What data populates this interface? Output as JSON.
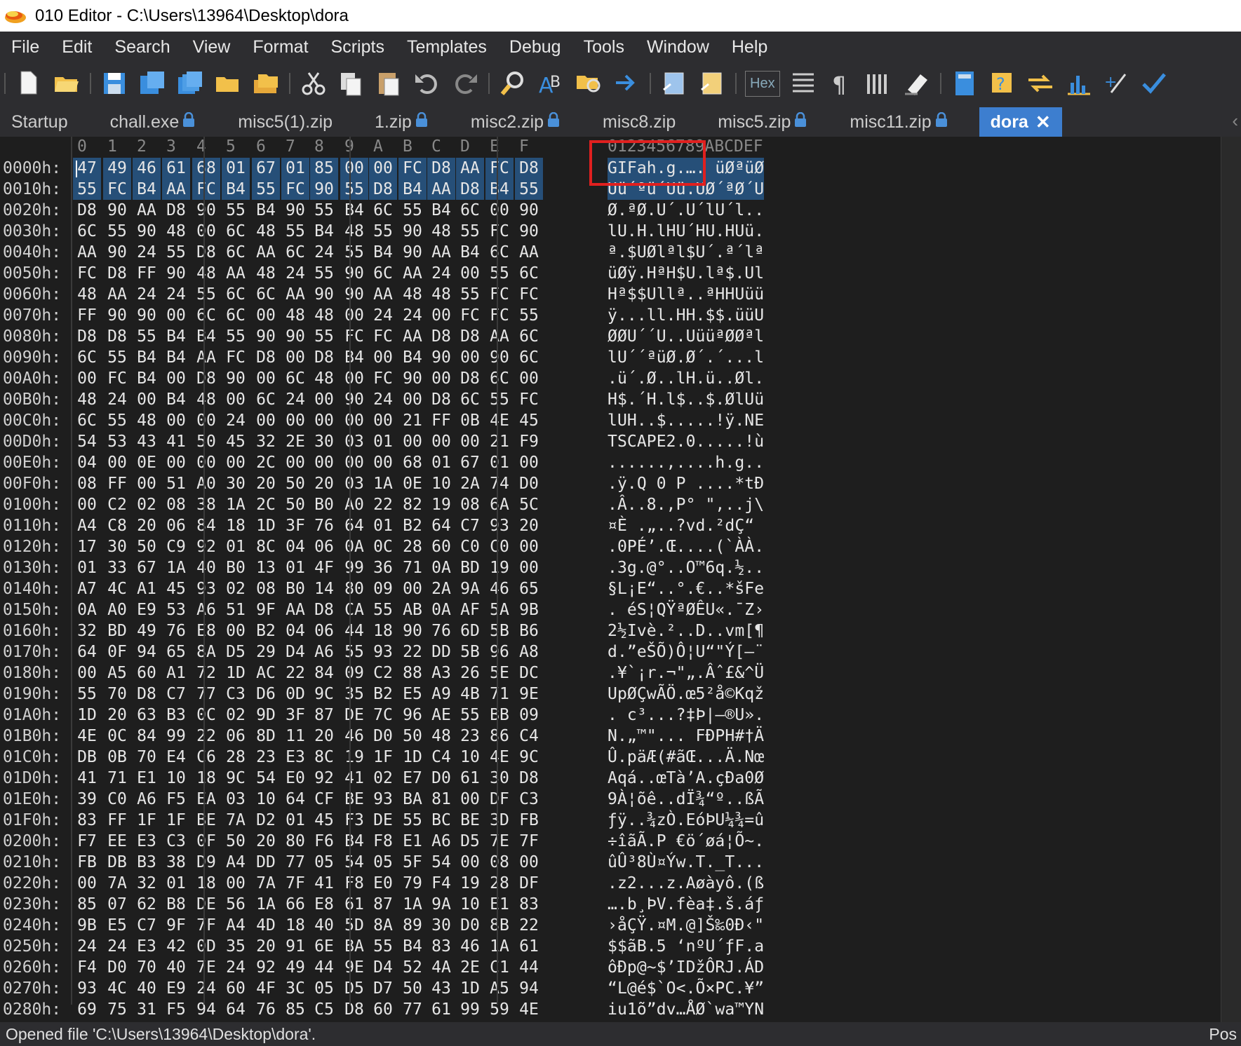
{
  "window": {
    "title": "010 Editor - C:\\Users\\13964\\Desktop\\dora"
  },
  "menu": [
    "File",
    "Edit",
    "Search",
    "View",
    "Format",
    "Scripts",
    "Templates",
    "Debug",
    "Tools",
    "Window",
    "Help"
  ],
  "toolbar": {
    "hex_label": "Hex",
    "icons": [
      "new-file-icon",
      "open-folder-icon",
      "save-icon",
      "save-as-icon",
      "save-all-icon",
      "folder-icon",
      "open-multiple-icon",
      "cut-icon",
      "copy-icon",
      "paste-icon",
      "undo-icon",
      "redo-icon",
      "find-icon",
      "replace-icon",
      "find-in-files-icon",
      "goto-icon",
      "run-script-icon",
      "run-template-icon",
      "hex-toggle-icon",
      "columns-icon",
      "paragraph-icon",
      "layout-icon",
      "highlight-icon",
      "calculator-icon",
      "inspector-icon",
      "compare-icon",
      "histogram-icon",
      "checksum-icon",
      "verify-icon"
    ]
  },
  "tabs": [
    {
      "label": "Startup",
      "lock": false
    },
    {
      "label": "chall.exe",
      "lock": true
    },
    {
      "label": "misc5(1).zip",
      "lock": false
    },
    {
      "label": "1.zip",
      "lock": true
    },
    {
      "label": "misc2.zip",
      "lock": true
    },
    {
      "label": "misc8.zip",
      "lock": false
    },
    {
      "label": "misc5.zip",
      "lock": true
    },
    {
      "label": "misc11.zip",
      "lock": true
    },
    {
      "label": "dora",
      "lock": false,
      "active": true
    }
  ],
  "hex_header": {
    "columns": [
      "0",
      "1",
      "2",
      "3",
      "4",
      "5",
      "6",
      "7",
      "8",
      "9",
      "A",
      "B",
      "C",
      "D",
      "E",
      "F"
    ],
    "ascii_header": "0123456789ABCDEF"
  },
  "rows": [
    {
      "addr": "0000h:",
      "bytes": [
        "47",
        "49",
        "46",
        "61",
        "68",
        "01",
        "67",
        "01",
        "85",
        "00",
        "00",
        "FC",
        "D8",
        "AA",
        "FC",
        "D8"
      ],
      "ascii": "GIFah.g.…. üØªüØ"
    },
    {
      "addr": "0010h:",
      "bytes": [
        "55",
        "FC",
        "B4",
        "AA",
        "FC",
        "B4",
        "55",
        "FC",
        "90",
        "55",
        "D8",
        "B4",
        "AA",
        "D8",
        "B4",
        "55"
      ],
      "ascii": "Uü´ªü´Uü.UØ´ªØ´U"
    },
    {
      "addr": "0020h:",
      "bytes": [
        "D8",
        "90",
        "AA",
        "D8",
        "90",
        "55",
        "B4",
        "90",
        "55",
        "B4",
        "6C",
        "55",
        "B4",
        "6C",
        "00",
        "90"
      ],
      "ascii": "Ø.ªØ.U´.U´lU´l.."
    },
    {
      "addr": "0030h:",
      "bytes": [
        "6C",
        "55",
        "90",
        "48",
        "00",
        "6C",
        "48",
        "55",
        "B4",
        "48",
        "55",
        "90",
        "48",
        "55",
        "FC",
        "90"
      ],
      "ascii": "lU.H.lHU´HU.HUü."
    },
    {
      "addr": "0040h:",
      "bytes": [
        "AA",
        "90",
        "24",
        "55",
        "D8",
        "6C",
        "AA",
        "6C",
        "24",
        "55",
        "B4",
        "90",
        "AA",
        "B4",
        "6C",
        "AA"
      ],
      "ascii": "ª.$UØlªl$U´.ª´lª"
    },
    {
      "addr": "0050h:",
      "bytes": [
        "FC",
        "D8",
        "FF",
        "90",
        "48",
        "AA",
        "48",
        "24",
        "55",
        "90",
        "6C",
        "AA",
        "24",
        "00",
        "55",
        "6C"
      ],
      "ascii": "üØÿ.HªH$U.lª$.Ul"
    },
    {
      "addr": "0060h:",
      "bytes": [
        "48",
        "AA",
        "24",
        "24",
        "55",
        "6C",
        "6C",
        "AA",
        "90",
        "90",
        "AA",
        "48",
        "48",
        "55",
        "FC",
        "FC"
      ],
      "ascii": "Hª$$Ullª..ªHHUüü"
    },
    {
      "addr": "0070h:",
      "bytes": [
        "FF",
        "90",
        "90",
        "00",
        "6C",
        "6C",
        "00",
        "48",
        "48",
        "00",
        "24",
        "24",
        "00",
        "FC",
        "FC",
        "55"
      ],
      "ascii": "ÿ...ll.HH.$$.üüU"
    },
    {
      "addr": "0080h:",
      "bytes": [
        "D8",
        "D8",
        "55",
        "B4",
        "B4",
        "55",
        "90",
        "90",
        "55",
        "FC",
        "FC",
        "AA",
        "D8",
        "D8",
        "AA",
        "6C"
      ],
      "ascii": "ØØU´´U..UüüªØØªl"
    },
    {
      "addr": "0090h:",
      "bytes": [
        "6C",
        "55",
        "B4",
        "B4",
        "AA",
        "FC",
        "D8",
        "00",
        "D8",
        "B4",
        "00",
        "B4",
        "90",
        "00",
        "90",
        "6C"
      ],
      "ascii": "lU´´ªüØ.Ø´.´...l"
    },
    {
      "addr": "00A0h:",
      "bytes": [
        "00",
        "FC",
        "B4",
        "00",
        "D8",
        "90",
        "00",
        "6C",
        "48",
        "00",
        "FC",
        "90",
        "00",
        "D8",
        "6C",
        "00"
      ],
      "ascii": ".ü´.Ø..lH.ü..Øl."
    },
    {
      "addr": "00B0h:",
      "bytes": [
        "48",
        "24",
        "00",
        "B4",
        "48",
        "00",
        "6C",
        "24",
        "00",
        "90",
        "24",
        "00",
        "D8",
        "6C",
        "55",
        "FC"
      ],
      "ascii": "H$.´H.l$..$.ØlUü"
    },
    {
      "addr": "00C0h:",
      "bytes": [
        "6C",
        "55",
        "48",
        "00",
        "00",
        "24",
        "00",
        "00",
        "00",
        "00",
        "00",
        "21",
        "FF",
        "0B",
        "4E",
        "45"
      ],
      "ascii": "lUH..$.....!ÿ.NE"
    },
    {
      "addr": "00D0h:",
      "bytes": [
        "54",
        "53",
        "43",
        "41",
        "50",
        "45",
        "32",
        "2E",
        "30",
        "03",
        "01",
        "00",
        "00",
        "00",
        "21",
        "F9"
      ],
      "ascii": "TSCAPE2.0.....!ù"
    },
    {
      "addr": "00E0h:",
      "bytes": [
        "04",
        "00",
        "0E",
        "00",
        "00",
        "00",
        "2C",
        "00",
        "00",
        "00",
        "00",
        "68",
        "01",
        "67",
        "01",
        "00"
      ],
      "ascii": "......,....h.g.."
    },
    {
      "addr": "00F0h:",
      "bytes": [
        "08",
        "FF",
        "00",
        "51",
        "A0",
        "30",
        "20",
        "50",
        "20",
        "03",
        "1A",
        "0E",
        "10",
        "2A",
        "74",
        "D0"
      ],
      "ascii": ".ÿ.Q 0 P ....*tÐ"
    },
    {
      "addr": "0100h:",
      "bytes": [
        "00",
        "C2",
        "02",
        "08",
        "38",
        "1A",
        "2C",
        "50",
        "B0",
        "A0",
        "22",
        "82",
        "19",
        "08",
        "6A",
        "5C"
      ],
      "ascii": ".Â..8.,P° \",..j\\"
    },
    {
      "addr": "0110h:",
      "bytes": [
        "A4",
        "C8",
        "20",
        "06",
        "84",
        "18",
        "1D",
        "3F",
        "76",
        "64",
        "01",
        "B2",
        "64",
        "C7",
        "93",
        "20"
      ],
      "ascii": "¤È .„..?vd.²dÇ“ "
    },
    {
      "addr": "0120h:",
      "bytes": [
        "17",
        "30",
        "50",
        "C9",
        "92",
        "01",
        "8C",
        "04",
        "06",
        "0A",
        "0C",
        "28",
        "60",
        "C0",
        "C0",
        "00"
      ],
      "ascii": ".0PÉ’.Œ....(`ÀÀ."
    },
    {
      "addr": "0130h:",
      "bytes": [
        "01",
        "33",
        "67",
        "1A",
        "40",
        "B0",
        "13",
        "01",
        "4F",
        "99",
        "36",
        "71",
        "0A",
        "BD",
        "19",
        "00"
      ],
      "ascii": ".3g.@°..O™6q.½.."
    },
    {
      "addr": "0140h:",
      "bytes": [
        "A7",
        "4C",
        "A1",
        "45",
        "93",
        "02",
        "08",
        "B0",
        "14",
        "80",
        "09",
        "00",
        "2A",
        "9A",
        "46",
        "65"
      ],
      "ascii": "§L¡E“..°.€..*šFe"
    },
    {
      "addr": "0150h:",
      "bytes": [
        "0A",
        "A0",
        "E9",
        "53",
        "A6",
        "51",
        "9F",
        "AA",
        "D8",
        "CA",
        "55",
        "AB",
        "0A",
        "AF",
        "5A",
        "9B"
      ],
      "ascii": ". éS¦QŸªØÊU«.¯Z›"
    },
    {
      "addr": "0160h:",
      "bytes": [
        "32",
        "BD",
        "49",
        "76",
        "E8",
        "00",
        "B2",
        "04",
        "06",
        "44",
        "18",
        "90",
        "76",
        "6D",
        "5B",
        "B6"
      ],
      "ascii": "2½Ivè.²..D..vm[¶"
    },
    {
      "addr": "0170h:",
      "bytes": [
        "64",
        "0F",
        "94",
        "65",
        "8A",
        "D5",
        "29",
        "D4",
        "A6",
        "55",
        "93",
        "22",
        "DD",
        "5B",
        "96",
        "A8"
      ],
      "ascii": "d.”eŠÕ)Ô¦U“\"Ý[–¨"
    },
    {
      "addr": "0180h:",
      "bytes": [
        "00",
        "A5",
        "60",
        "A1",
        "72",
        "1D",
        "AC",
        "22",
        "84",
        "09",
        "C2",
        "88",
        "A3",
        "26",
        "5E",
        "DC"
      ],
      "ascii": ".¥`¡r.¬\"„.Âˆ£&^Ü"
    },
    {
      "addr": "0190h:",
      "bytes": [
        "55",
        "70",
        "D8",
        "C7",
        "77",
        "C3",
        "D6",
        "0D",
        "9C",
        "35",
        "B2",
        "E5",
        "A9",
        "4B",
        "71",
        "9E"
      ],
      "ascii": "UpØÇwÃÖ.œ5²å©Kqž"
    },
    {
      "addr": "01A0h:",
      "bytes": [
        "1D",
        "20",
        "63",
        "B3",
        "0C",
        "02",
        "9D",
        "3F",
        "87",
        "DE",
        "7C",
        "96",
        "AE",
        "55",
        "BB",
        "09"
      ],
      "ascii": ". c³...?‡Þ|–®U»."
    },
    {
      "addr": "01B0h:",
      "bytes": [
        "4E",
        "0C",
        "84",
        "99",
        "22",
        "06",
        "8D",
        "11",
        "20",
        "46",
        "D0",
        "50",
        "48",
        "23",
        "86",
        "C4"
      ],
      "ascii": "N.„™\"... FÐPH#†Ä"
    },
    {
      "addr": "01C0h:",
      "bytes": [
        "DB",
        "0B",
        "70",
        "E4",
        "C6",
        "28",
        "23",
        "E3",
        "8C",
        "19",
        "1F",
        "1D",
        "C4",
        "10",
        "4E",
        "9C"
      ],
      "ascii": "Û.päÆ(#ãŒ...Ä.Nœ"
    },
    {
      "addr": "01D0h:",
      "bytes": [
        "41",
        "71",
        "E1",
        "10",
        "18",
        "9C",
        "54",
        "E0",
        "92",
        "41",
        "02",
        "E7",
        "D0",
        "61",
        "30",
        "D8"
      ],
      "ascii": "Aqá..œTà’A.çÐa0Ø"
    },
    {
      "addr": "01E0h:",
      "bytes": [
        "39",
        "C0",
        "A6",
        "F5",
        "EA",
        "03",
        "10",
        "64",
        "CF",
        "BE",
        "93",
        "BA",
        "81",
        "00",
        "DF",
        "C3"
      ],
      "ascii": "9À¦õê..dÏ¾“º..ßÃ"
    },
    {
      "addr": "01F0h:",
      "bytes": [
        "83",
        "FF",
        "1F",
        "1F",
        "BE",
        "7A",
        "D2",
        "01",
        "45",
        "F3",
        "DE",
        "55",
        "BC",
        "BE",
        "3D",
        "FB"
      ],
      "ascii": "ƒÿ..¾zÒ.EóÞU¼¾=û"
    },
    {
      "addr": "0200h:",
      "bytes": [
        "F7",
        "EE",
        "E3",
        "C3",
        "0F",
        "50",
        "20",
        "80",
        "F6",
        "B4",
        "F8",
        "E1",
        "A6",
        "D5",
        "7E",
        "7F"
      ],
      "ascii": "÷îãÃ.P €ö´øá¦Õ~."
    },
    {
      "addr": "0210h:",
      "bytes": [
        "FB",
        "DB",
        "B3",
        "38",
        "D9",
        "A4",
        "DD",
        "77",
        "05",
        "54",
        "05",
        "5F",
        "54",
        "00",
        "08",
        "00"
      ],
      "ascii": "ûÛ³8Ù¤Ýw.T._T..."
    },
    {
      "addr": "0220h:",
      "bytes": [
        "00",
        "7A",
        "32",
        "01",
        "18",
        "00",
        "7A",
        "7F",
        "41",
        "F8",
        "E0",
        "79",
        "F4",
        "19",
        "28",
        "DF"
      ],
      "ascii": ".z2...z.Aøàyô.(ß"
    },
    {
      "addr": "0230h:",
      "bytes": [
        "85",
        "07",
        "62",
        "B8",
        "DE",
        "56",
        "1A",
        "66",
        "E8",
        "61",
        "87",
        "1A",
        "9A",
        "10",
        "E1",
        "83"
      ],
      "ascii": "….b¸ÞV.fèa‡.š.áƒ"
    },
    {
      "addr": "0240h:",
      "bytes": [
        "9B",
        "E5",
        "C7",
        "9F",
        "7F",
        "A4",
        "4D",
        "18",
        "40",
        "5D",
        "8A",
        "89",
        "30",
        "D0",
        "8B",
        "22"
      ],
      "ascii": "›åÇŸ.¤M.@]Š‰0Ð‹\""
    },
    {
      "addr": "0250h:",
      "bytes": [
        "24",
        "24",
        "E3",
        "42",
        "0D",
        "35",
        "20",
        "91",
        "6E",
        "BA",
        "55",
        "B4",
        "83",
        "46",
        "1A",
        "61"
      ],
      "ascii": "$$ãB.5 ‘nºU´ƒF.a"
    },
    {
      "addr": "0260h:",
      "bytes": [
        "F4",
        "D0",
        "70",
        "40",
        "7E",
        "24",
        "92",
        "49",
        "44",
        "9E",
        "D4",
        "52",
        "4A",
        "2E",
        "C1",
        "44"
      ],
      "ascii": "ôÐp@~$’IDžÔRJ.ÁD"
    },
    {
      "addr": "0270h:",
      "bytes": [
        "93",
        "4C",
        "40",
        "E9",
        "24",
        "60",
        "4F",
        "3C",
        "05",
        "D5",
        "D7",
        "50",
        "43",
        "1D",
        "A5",
        "94"
      ],
      "ascii": "“L@é$`O<.Õ×PC.¥”"
    },
    {
      "addr": "0280h:",
      "bytes": [
        "69",
        "75",
        "31",
        "F5",
        "94",
        "64",
        "76",
        "85",
        "C5",
        "D8",
        "60",
        "77",
        "61",
        "99",
        "59",
        "4E"
      ],
      "ascii": "iu1õ”dv…ÅØ`wa™YN"
    }
  ],
  "status": {
    "message": "Opened file 'C:\\Users\\13964\\Desktop\\dora'.",
    "pos": "Pos"
  }
}
